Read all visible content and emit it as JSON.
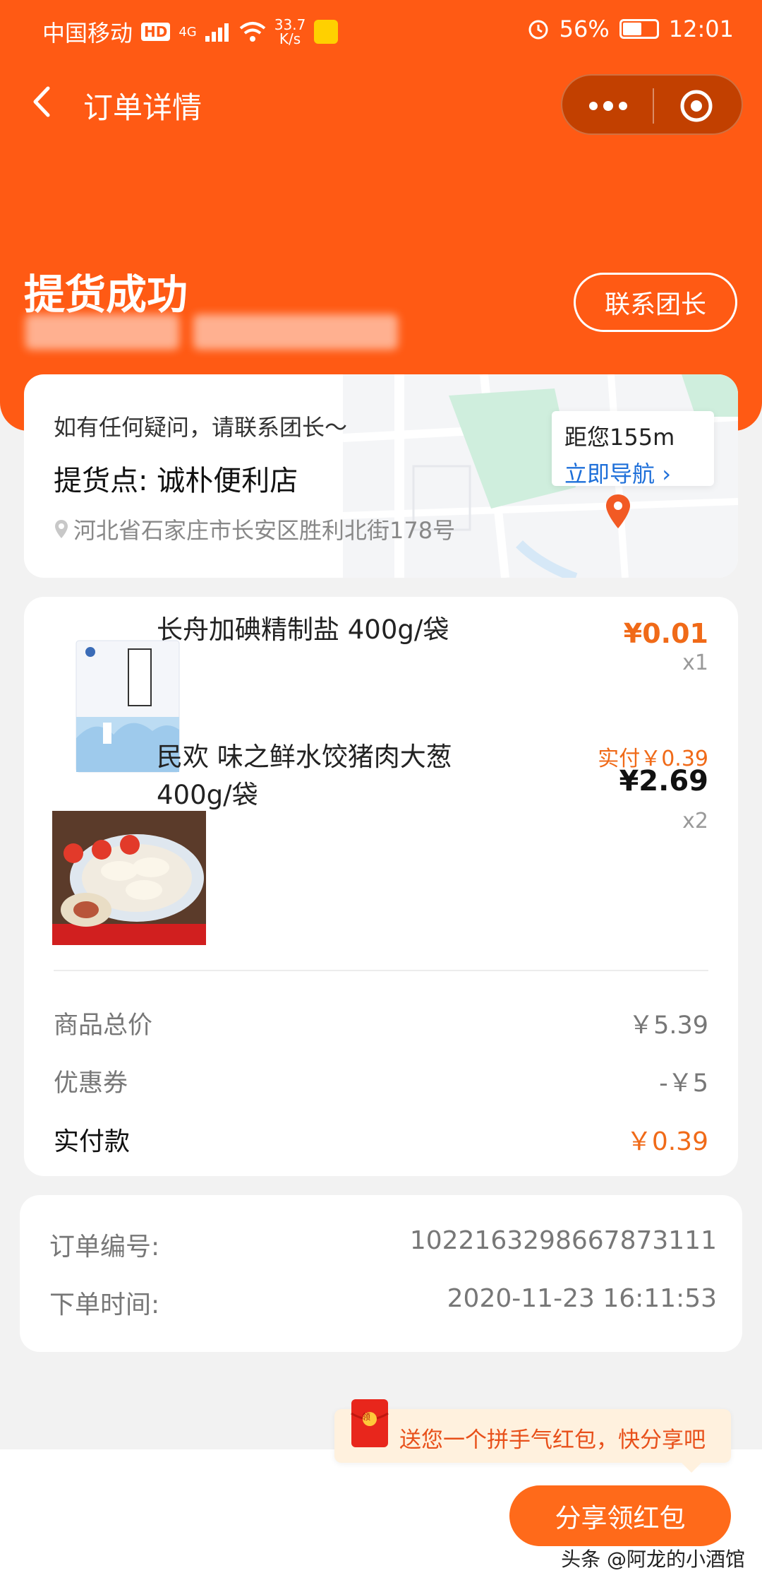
{
  "status_bar": {
    "carrier": "中国移动",
    "hd": "HD",
    "signal": "4G",
    "net_speed_value": "33.7",
    "net_speed_unit": "K/s",
    "battery": "56%",
    "time": "12:01"
  },
  "nav": {
    "title": "订单详情"
  },
  "order_status": {
    "title": "提货成功",
    "contact_button": "联系团长"
  },
  "pickup": {
    "hint": "如有任何疑问，请联系团长～",
    "name": "提货点: 诚朴便利店",
    "address": "河北省石家庄市长安区胜利北街178号",
    "distance": "距您155m",
    "navigate": "立即导航"
  },
  "items": [
    {
      "name_line1": "长舟加碘精制盐 400g/袋",
      "price": "¥0.01",
      "quantity": "x1"
    },
    {
      "name_line1": "民欢 味之鲜水饺猪肉大葱",
      "name_line2": "400g/袋",
      "actual_price": "实付￥0.39",
      "price": "¥2.69",
      "quantity": "x2"
    }
  ],
  "summary": {
    "total_label": "商品总价",
    "total_value": "￥5.39",
    "coupon_label": "优惠券",
    "coupon_value": "-￥5",
    "paid_label": "实付款",
    "paid_value": "￥0.39"
  },
  "order_info": {
    "number_label": "订单编号:",
    "number_value": "1022163298667873111",
    "time_label": "下单时间:",
    "time_value": "2020-11-23 16:11:53"
  },
  "share": {
    "tip": "送您一个拼手气红包，快分享吧",
    "envelope_char": "领",
    "button": "分享领红包"
  },
  "watermark": "头条 @阿龙的小酒馆",
  "colors": {
    "brand": "#ff5a14",
    "price": "#f06a18",
    "link": "#1e6fd9"
  }
}
